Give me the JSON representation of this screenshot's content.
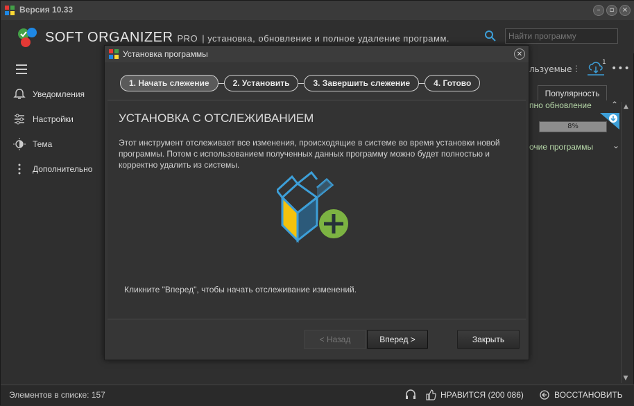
{
  "app": {
    "version": "Версия 10.33",
    "brand": "SOFT ORGANIZER",
    "edition": "PRO",
    "tagline": "| установка, обновление и полное удаление программ."
  },
  "search": {
    "placeholder": "Найти программу"
  },
  "sidebar": {
    "items": [
      {
        "label": "Уведомления",
        "icon": "bell-icon"
      },
      {
        "label": "Настройки",
        "icon": "sliders-icon"
      },
      {
        "label": "Тема",
        "icon": "theme-icon"
      },
      {
        "label": "Дополнительно",
        "icon": "more-vertical-icon"
      }
    ]
  },
  "rightpane": {
    "label_fragment": "льзуемые",
    "update_badge": "1",
    "column_popular": "Популярность",
    "group_fragment1": "пно обновление",
    "progress": "8%",
    "group_fragment2": "очие программы"
  },
  "dialog": {
    "title": "Установка программы",
    "steps": [
      "1. Начать слежение",
      "2. Установить",
      "3. Завершить слежение",
      "4. Готово"
    ],
    "heading": "УСТАНОВКА С ОТСЛЕЖИВАНИЕМ",
    "description": "Этот инструмент отслеживает все изменения, происходящие в системе во время установки новой программы. Потом с использованием полученных данных программу можно будет полностью и корректно удалить из системы.",
    "hint": "Кликните \"Вперед\", чтобы начать отслеживание изменений.",
    "btn_back": "< Назад",
    "btn_next": "Вперед >",
    "btn_close": "Закрыть"
  },
  "status": {
    "count": "Элементов в списке: 157",
    "like": "НРАВИТСЯ (200 086)",
    "restore": "ВОССТАНОВИТЬ"
  },
  "colors": {
    "accent_blue": "#3d9fd8",
    "accent_green": "#7cb342",
    "box_yellow": "#f4c20d"
  }
}
